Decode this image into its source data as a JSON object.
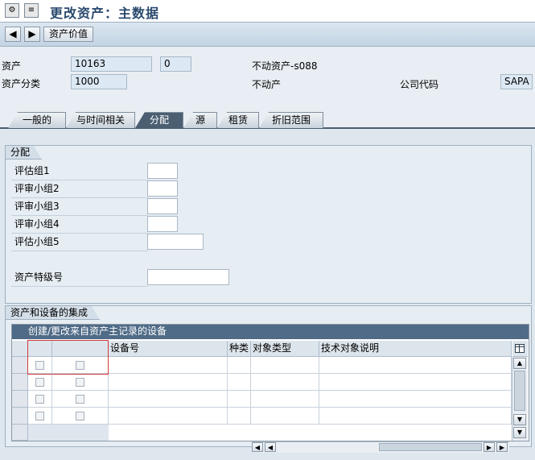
{
  "window": {
    "title": "更改资产：主数据",
    "icons": [
      "sap-menu-icon",
      "menu-bar-toggle-icon"
    ]
  },
  "toolbar": {
    "prev_icon": "◀",
    "next_icon": "▶",
    "asset_values_label": "资产价值"
  },
  "header": {
    "asset_label": "资产",
    "asset_number": "10163",
    "sub_number": "0",
    "asset_description": "不动资产-s088",
    "asset_class_label": "资产分类",
    "asset_class": "1000",
    "asset_class_description": "不动产",
    "company_code_label": "公司代码",
    "company_code": "SAPA"
  },
  "tabs": [
    {
      "label": "一般的",
      "active": false
    },
    {
      "label": "与时间相关",
      "active": false
    },
    {
      "label": "分配",
      "active": true
    },
    {
      "label": "源",
      "active": false
    },
    {
      "label": "租赁",
      "active": false
    },
    {
      "label": "折旧范围",
      "active": false
    }
  ],
  "assignment": {
    "group_title": "分配",
    "fields": [
      {
        "label": "评估组1",
        "value": ""
      },
      {
        "label": "评审小组2",
        "value": ""
      },
      {
        "label": "评审小组3",
        "value": ""
      },
      {
        "label": "评审小组4",
        "value": ""
      },
      {
        "label": "评估小组5",
        "value": ""
      }
    ],
    "super_number_label": "资产特级号",
    "super_number_value": ""
  },
  "integration": {
    "group_title": "资产和设备的集成",
    "table_title": "创建/更改来自资产主记录的设备",
    "columns": [
      "",
      "",
      "设备号",
      "种类",
      "对象类型",
      "技术对象说明"
    ],
    "config_icon": "table-settings-icon"
  }
}
